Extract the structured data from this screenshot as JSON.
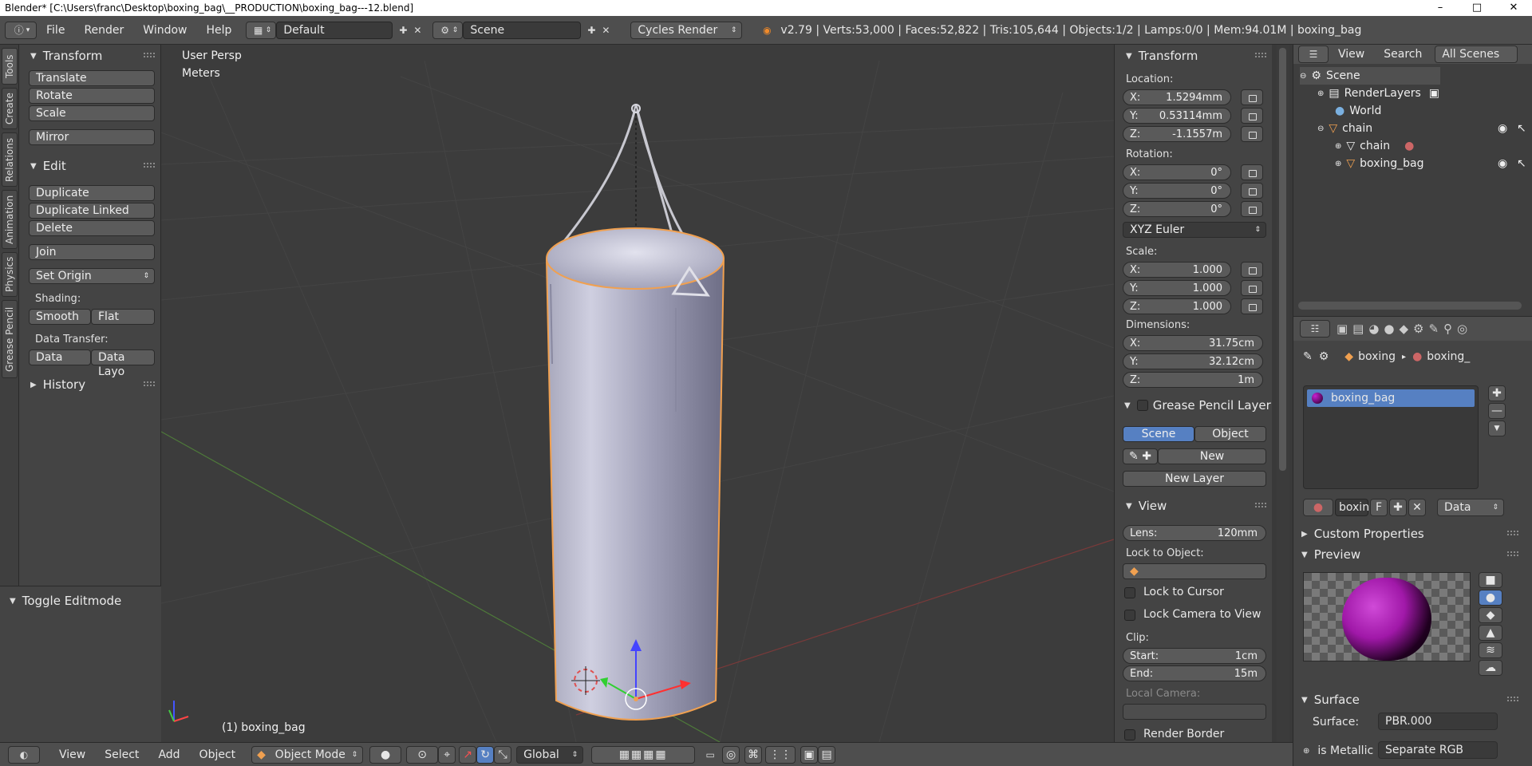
{
  "window": {
    "title": "Blender* [C:\\Users\\franc\\Desktop\\boxing_bag\\__PRODUCTION\\boxing_bag---12.blend]",
    "controls": [
      "–",
      "□",
      "✕"
    ]
  },
  "topbar": {
    "menus": [
      "File",
      "Render",
      "Window",
      "Help"
    ],
    "layout": "Default",
    "scene": "Scene",
    "engine": "Cycles Render",
    "stats": "v2.79 | Verts:53,000 | Faces:52,822 | Tris:105,644 | Objects:1/2 | Lamps:0/0 | Mem:94.01M | boxing_bag"
  },
  "tooltabs": [
    "Tools",
    "Create",
    "Relations",
    "Animation",
    "Physics",
    "Grease Pencil"
  ],
  "toolshelf": {
    "transform_title": "Transform",
    "transform_buttons": [
      "Translate",
      "Rotate",
      "Scale",
      "Mirror"
    ],
    "edit_title": "Edit",
    "edit_buttons": [
      "Duplicate",
      "Duplicate Linked",
      "Delete",
      "Join"
    ],
    "set_origin": "Set Origin",
    "shading_label": "Shading:",
    "shading_smooth": "Smooth",
    "shading_flat": "Flat",
    "data_transfer_label": "Data Transfer:",
    "data_btn": "Data",
    "data_layout_btn": "Data Layo",
    "history_title": "History",
    "toggle_editmode": "Toggle Editmode"
  },
  "viewport": {
    "view_name": "User Persp",
    "units": "Meters",
    "object_label": "(1) boxing_bag"
  },
  "npanel": {
    "transform_title": "Transform",
    "location_label": "Location:",
    "location": [
      {
        "axis": "X:",
        "value": "1.5294mm"
      },
      {
        "axis": "Y:",
        "value": "0.53114mm"
      },
      {
        "axis": "Z:",
        "value": "-1.1557m"
      }
    ],
    "rotation_label": "Rotation:",
    "rotation": [
      {
        "axis": "X:",
        "value": "0°"
      },
      {
        "axis": "Y:",
        "value": "0°"
      },
      {
        "axis": "Z:",
        "value": "0°"
      }
    ],
    "rotation_mode": "XYZ Euler",
    "scale_label": "Scale:",
    "scale": [
      {
        "axis": "X:",
        "value": "1.000"
      },
      {
        "axis": "Y:",
        "value": "1.000"
      },
      {
        "axis": "Z:",
        "value": "1.000"
      }
    ],
    "dimensions_label": "Dimensions:",
    "dimensions": [
      {
        "axis": "X:",
        "value": "31.75cm"
      },
      {
        "axis": "Y:",
        "value": "32.12cm"
      },
      {
        "axis": "Z:",
        "value": "1m"
      }
    ],
    "gp_title": "Grease Pencil Layer",
    "gp_scene": "Scene",
    "gp_object": "Object",
    "gp_new": "New",
    "gp_new_layer": "New Layer",
    "view_title": "View",
    "lens_label": "Lens:",
    "lens_value": "120mm",
    "lock_object_label": "Lock to Object:",
    "lock_cursor": "Lock to Cursor",
    "lock_camera": "Lock Camera to View",
    "clip_label": "Clip:",
    "clip_start_label": "Start:",
    "clip_start": "1cm",
    "clip_end_label": "End:",
    "clip_end": "15m",
    "local_camera_label": "Local Camera:",
    "render_border": "Render Border"
  },
  "outliner": {
    "menus": [
      "View",
      "Search"
    ],
    "filter": "All Scenes",
    "rows": [
      "Scene",
      "RenderLayers",
      "World",
      "chain",
      "chain",
      "boxing_bag"
    ]
  },
  "properties": {
    "breadcrumb_1": "boxing",
    "breadcrumb_2": "boxing_",
    "material_slot": "boxing_bag",
    "material_name": "boxin",
    "fake_user": "F",
    "link": "Data",
    "custom_props": "Custom Properties",
    "preview_title": "Preview",
    "surface_title": "Surface",
    "surface_label": "Surface:",
    "surface_value": "PBR.000",
    "metallic_label": "is Metallic",
    "metallic_value": "Separate RGB"
  },
  "bottombar": {
    "menus": [
      "View",
      "Select",
      "Add",
      "Object"
    ],
    "mode": "Object Mode",
    "orientation": "Global"
  },
  "colors": {
    "accent_blue": "#5680c2",
    "selection_orange": "#f0a050",
    "material_magenta": "#c81ed2"
  }
}
